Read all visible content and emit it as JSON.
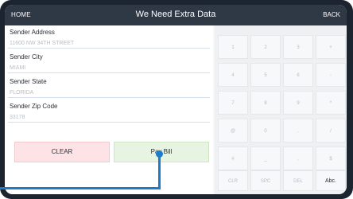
{
  "header": {
    "home_label": "HOME",
    "title": "We Need Extra Data",
    "back_label": "BACK"
  },
  "form": {
    "fields": [
      {
        "label": "Sender Address",
        "value": "11600 NW 34TH STREET"
      },
      {
        "label": "Sender City",
        "value": "MIAMI"
      },
      {
        "label": "Sender State",
        "value": "FLORIDA"
      },
      {
        "label": "Sender Zip Code",
        "value": "33178"
      }
    ],
    "clear_label": "CLEAR",
    "pay_label": "Pay Bill"
  },
  "keypad": {
    "keys": [
      "1",
      "2",
      "3",
      "+",
      "4",
      "5",
      "6",
      "-",
      "7",
      "8",
      "9",
      "*",
      "@",
      "0",
      ".",
      "/",
      "#",
      "_",
      ",",
      "$",
      "CLR",
      "SPC",
      "DEL",
      "Abc."
    ]
  },
  "colors": {
    "header_bg": "#2f3845",
    "clear_bg": "#fde3e6",
    "pay_bg": "#e8f4e2",
    "pointer": "#1e7bcc"
  }
}
